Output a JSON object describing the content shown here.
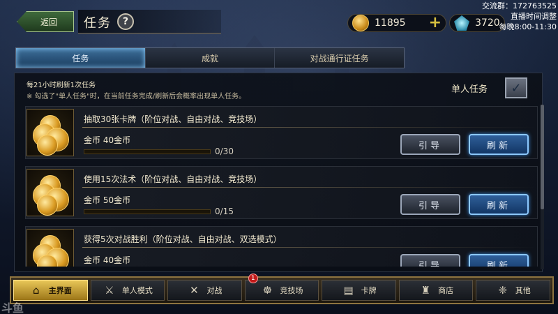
{
  "header": {
    "back_label": "返回",
    "title": "任务",
    "help_icon": "?",
    "gold": "11895",
    "gems": "3720",
    "plus_icon": "+"
  },
  "overlay": {
    "line1": "交流群：172763525",
    "line2": "直播时间调整",
    "line3": "每晚8:00-11:30"
  },
  "tabs": [
    {
      "label": "任务",
      "active": true
    },
    {
      "label": "成就",
      "active": false
    },
    {
      "label": "对战通行证任务",
      "active": false
    }
  ],
  "info": {
    "refresh_note": "每21小时刷新1次任务",
    "solo_note": "※ 勾选了\"单人任务\"时，在当前任务完成/刷新后会概率出现单人任务。",
    "solo_label": "单人任务",
    "solo_checked": true,
    "check_glyph": "✓"
  },
  "tasks": [
    {
      "title": "抽取30张卡牌（阶位对战、自由对战、竞技场）",
      "reward": "金币 40金币",
      "progress": 0,
      "progress_text": "0/30",
      "guide_label": "引导",
      "refresh_label": "刷新"
    },
    {
      "title": "使用15次法术（阶位对战、自由对战、竞技场）",
      "reward": "金币 50金币",
      "progress": 0,
      "progress_text": "0/15",
      "guide_label": "引导",
      "refresh_label": "刷新"
    },
    {
      "title": "获得5次对战胜利（阶位对战、自由对战、双选模式）",
      "reward": "金币 40金币",
      "progress": 0,
      "progress_text": "",
      "guide_label": "引导",
      "refresh_label": "刷新"
    }
  ],
  "bottom_nav": [
    {
      "label": "主界面",
      "icon": "home-icon",
      "glyph": "⌂",
      "active": true
    },
    {
      "label": "单人模式",
      "icon": "sword-icon",
      "glyph": "⚔",
      "active": false
    },
    {
      "label": "对战",
      "icon": "crossed-swords-icon",
      "glyph": "✕",
      "active": false
    },
    {
      "label": "竞技场",
      "icon": "arena-icon",
      "glyph": "☸",
      "active": false,
      "badge": "1"
    },
    {
      "label": "卡牌",
      "icon": "cards-icon",
      "glyph": "▤",
      "active": false
    },
    {
      "label": "商店",
      "icon": "shop-icon",
      "glyph": "♜",
      "active": false
    },
    {
      "label": "其他",
      "icon": "other-icon",
      "glyph": "❈",
      "active": false
    }
  ],
  "watermark": "斗鱼"
}
